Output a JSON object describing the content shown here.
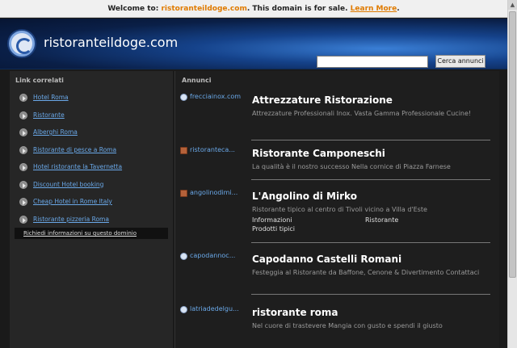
{
  "topbar": {
    "prefix": "Welcome to:",
    "domain": "ristoranteildoge.com",
    "suffix": ". This domain is for sale.",
    "link": "Learn More",
    "end": "."
  },
  "header": {
    "site_name": "ristoranteildoge.com",
    "search_value": "",
    "search_button": "Cerca annunci"
  },
  "sidebar": {
    "title": "Link correlati",
    "items": [
      {
        "label": "Hotel Roma"
      },
      {
        "label": "Ristorante"
      },
      {
        "label": "Alberghi Roma"
      },
      {
        "label": "Ristorante di pesce a Roma"
      },
      {
        "label": "Hotel ristorante la Tavernetta"
      },
      {
        "label": "Discount Hotel booking"
      },
      {
        "label": "Cheap Hotel in Rome Italy"
      },
      {
        "label": "Ristorante pizzeria Roma"
      }
    ],
    "info_link": "Richiedi informazioni su questo dominio"
  },
  "main": {
    "title": "Annunci",
    "ads": [
      {
        "source": "frecciainox.com",
        "title": "Attrezzature Ristorazione",
        "desc": "Attrezzature Professionali Inox. Vasta Gamma Professionale Cucine!",
        "icon": "globe-icon"
      },
      {
        "source": "ristoranteca...",
        "title": "Ristorante Camponeschi",
        "desc": "La qualità è il nostro successo Nella cornice di Piazza Farnese",
        "icon": "site-thumbnail-icon"
      },
      {
        "source": "angolinodimi...",
        "title": "L'Angolino di Mirko",
        "desc": "Ristorante tipico al centro di Tivoli vicino a Villa d'Este",
        "icon": "site-thumbnail-icon",
        "sublinks": [
          "Informazioni",
          "Ristorante",
          "Prodotti tipici"
        ]
      },
      {
        "source": "capodannoc...",
        "title": "Capodanno Castelli Romani",
        "desc": "Festeggia al Ristorante da Baffone, Cenone & Divertimento Contattaci",
        "icon": "globe-icon"
      },
      {
        "source": "latriadedelgu...",
        "title": "ristorante roma",
        "desc": "Nel cuore di trastevere Mangia con gusto e spendi il giusto",
        "icon": "globe-icon"
      }
    ]
  },
  "colors": {
    "link": "#6aa8e8",
    "accent": "#e07b00",
    "background": "#1a1a1a"
  }
}
